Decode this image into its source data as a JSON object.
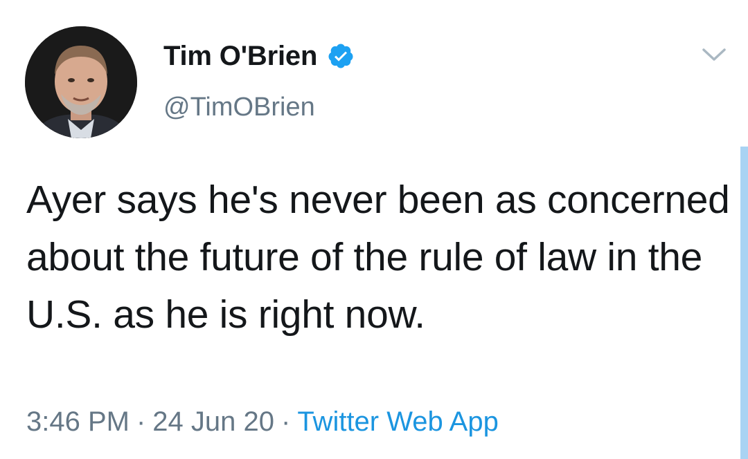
{
  "tweet": {
    "author": {
      "name": "Tim O'Brien",
      "handle": "@TimOBrien",
      "verified": true
    },
    "text": "Ayer says he's never been as concerned about the future of the rule of law in the U.S. as he is right now.",
    "time": "3:46 PM",
    "separator": "·",
    "date": "24 Jun 20",
    "source": "Twitter Web App"
  },
  "icons": {
    "verified": "verified-badge-icon",
    "menu": "chevron-down-icon"
  },
  "colors": {
    "text": "#14171a",
    "secondary": "#657786",
    "accent": "#1da1f2",
    "link": "#1b95e0"
  }
}
